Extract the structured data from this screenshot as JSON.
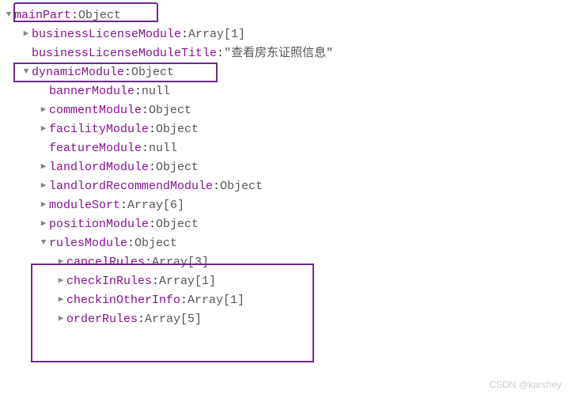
{
  "rows": [
    {
      "indent": 0,
      "toggle": "down",
      "key": "mainPart",
      "value": "Object",
      "valueType": "obj"
    },
    {
      "indent": 1,
      "toggle": "right",
      "key": "businessLicenseModule",
      "value": "Array[1]",
      "valueType": "obj"
    },
    {
      "indent": 1,
      "toggle": "empty",
      "key": "businessLicenseModuleTitle",
      "value": "\"查看房东证照信息\"",
      "valueType": "str"
    },
    {
      "indent": 1,
      "toggle": "down",
      "key": "dynamicModule",
      "value": "Object",
      "valueType": "obj"
    },
    {
      "indent": 2,
      "toggle": "empty",
      "key": "bannerModule",
      "value": "null",
      "valueType": "obj"
    },
    {
      "indent": 2,
      "toggle": "right",
      "key": "commentModule",
      "value": "Object",
      "valueType": "obj"
    },
    {
      "indent": 2,
      "toggle": "right",
      "key": "facilityModule",
      "value": "Object",
      "valueType": "obj"
    },
    {
      "indent": 2,
      "toggle": "empty",
      "key": "featureModule",
      "value": "null",
      "valueType": "obj"
    },
    {
      "indent": 2,
      "toggle": "right",
      "key": "landlordModule",
      "value": "Object",
      "valueType": "obj"
    },
    {
      "indent": 2,
      "toggle": "right",
      "key": "landlordRecommendModule",
      "value": "Object",
      "valueType": "obj"
    },
    {
      "indent": 2,
      "toggle": "right",
      "key": "moduleSort",
      "value": "Array[6]",
      "valueType": "obj"
    },
    {
      "indent": 2,
      "toggle": "right",
      "key": "positionModule",
      "value": "Object",
      "valueType": "obj"
    },
    {
      "indent": 2,
      "toggle": "down",
      "key": "rulesModule",
      "value": "Object",
      "valueType": "obj"
    },
    {
      "indent": 3,
      "toggle": "right",
      "key": "cancelRules",
      "value": "Array[3]",
      "valueType": "obj"
    },
    {
      "indent": 3,
      "toggle": "right",
      "key": "checkInRules",
      "value": "Array[1]",
      "valueType": "obj"
    },
    {
      "indent": 3,
      "toggle": "right",
      "key": "checkinOtherInfo",
      "value": "Array[1]",
      "valueType": "obj"
    },
    {
      "indent": 3,
      "toggle": "right",
      "key": "orderRules",
      "value": "Array[5]",
      "valueType": "obj"
    }
  ],
  "watermark": "CSDN @karshey",
  "toggleGlyphs": {
    "down": "▼",
    "right": "▶",
    "empty": "▶"
  },
  "colon": ": "
}
